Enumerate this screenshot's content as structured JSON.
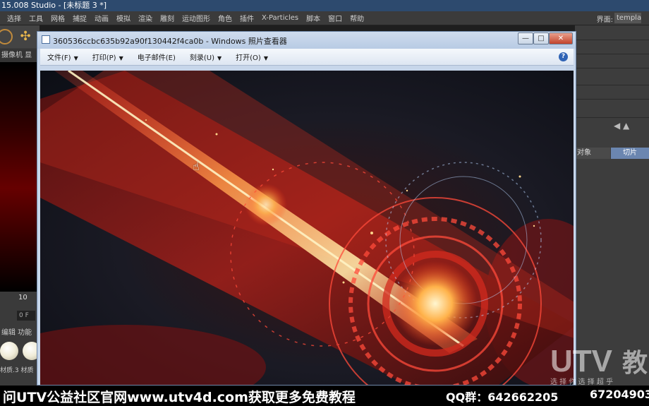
{
  "c4d": {
    "title": "15.008 Studio - [未标题 3 *]",
    "menu": [
      "选择",
      "工具",
      "网格",
      "捕捉",
      "动画",
      "模拟",
      "渲染",
      "雕刻",
      "运动图形",
      "角色",
      "插件",
      "X-Particles",
      "脚本",
      "窗口",
      "帮助"
    ],
    "layout_label": "界面:",
    "layout_value": "template",
    "left_tabs": "摄像机  显",
    "timeline_number": "10",
    "frame_field": "0 F",
    "material_tabs": "编辑  功能",
    "material_label": "材质.3   材质",
    "right_tabs": {
      "object": "对象",
      "slice": "切片"
    }
  },
  "photo_viewer": {
    "title": "360536ccbc635b92a90f130442f4ca0b - Windows 照片查看器",
    "menu": [
      {
        "label": "文件(F)"
      },
      {
        "label": "打印(P)"
      },
      {
        "label": "电子邮件(E)"
      },
      {
        "label": "刻录(U)"
      },
      {
        "label": "打开(O)"
      }
    ],
    "help": "?",
    "buttons": {
      "minimize": "—",
      "maximize": "□",
      "close": "✕"
    }
  },
  "banner": {
    "left_text": "问UTV公益社区官网www.utv4d.com获取更多免费教程",
    "qq_text": "QQ群：642662205",
    "qq_text2": "67204903"
  },
  "watermark": {
    "brand": "UTV",
    "brand_suffix": "教",
    "slogan": "选 择  你 选 择   超 乎"
  },
  "icons": [
    "arrow-select-icon",
    "move-icon",
    "app-icon",
    "help-icon",
    "hand-cursor-icon"
  ]
}
